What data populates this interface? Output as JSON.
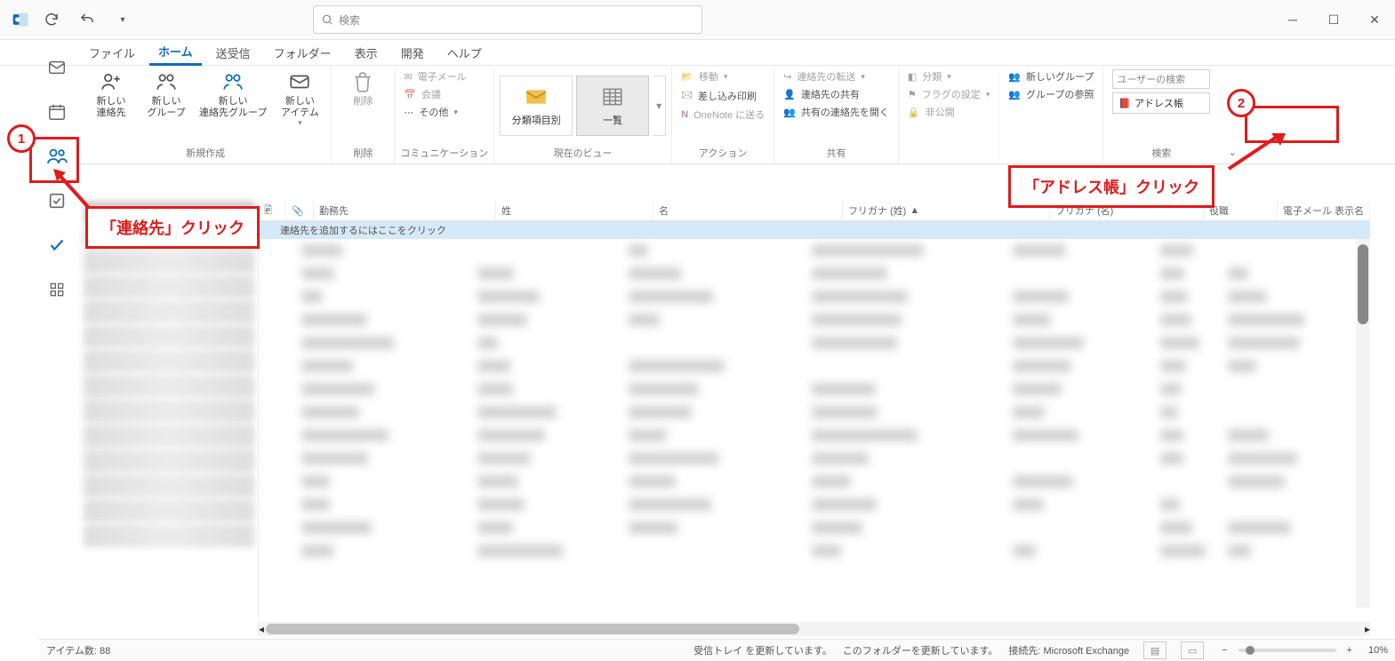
{
  "search": {
    "placeholder": "検索"
  },
  "tabs": {
    "file": "ファイル",
    "home": "ホーム",
    "sendreceive": "送受信",
    "folder": "フォルダー",
    "view": "表示",
    "developer": "開発",
    "help": "ヘルプ"
  },
  "ribbon": {
    "newgroup": {
      "label": "新規作成",
      "newcontact": "新しい\n連絡先",
      "newgroupitem": "新しい\nグループ",
      "newcontactgroup": "新しい\n連絡先グループ",
      "newitems": "新しい\nアイテム"
    },
    "deletegroup": {
      "label": "削除",
      "delete": "削除"
    },
    "comm": {
      "label": "コミュニケーション",
      "email": "電子メール",
      "meeting": "会議",
      "other": "その他"
    },
    "view": {
      "label": "現在のビュー",
      "bycat": "分類項目別",
      "list": "一覧"
    },
    "action": {
      "label": "アクション",
      "move": "移動",
      "mailmerge": "差し込み印刷",
      "onenote": "OneNote に送る"
    },
    "share": {
      "label": "共有",
      "forward": "連絡先の転送",
      "sharecontacts": "連絡先の共有",
      "openshared": "共有の連絡先を開く"
    },
    "tags": {
      "categorize": "分類",
      "flag": "フラグの設定",
      "private": "非公開"
    },
    "groups": {
      "newgroup": "新しいグループ",
      "browse": "グループの参照"
    },
    "find": {
      "label": "検索",
      "searchuser": "ユーザーの検索",
      "addressbook": "アドレス帳"
    }
  },
  "columns": {
    "company": "勤務先",
    "lastname": "姓",
    "firstname": "名",
    "furigana_last": "フリガナ (姓)",
    "furigana_first": "フリガナ (名)",
    "title": "役職",
    "emaildisplay": "電子メール 表示名"
  },
  "list": {
    "newrow": "連絡先を追加するにはここをクリック"
  },
  "status": {
    "itemcount": "アイテム数: 88",
    "updating1": "受信トレイ を更新しています。",
    "updating2": "このフォルダーを更新しています。",
    "conn": "接続先: Microsoft Exchange",
    "zoom": "10%"
  },
  "callout": {
    "one": "「連絡先」クリック",
    "two": "「アドレス帳」クリック"
  }
}
